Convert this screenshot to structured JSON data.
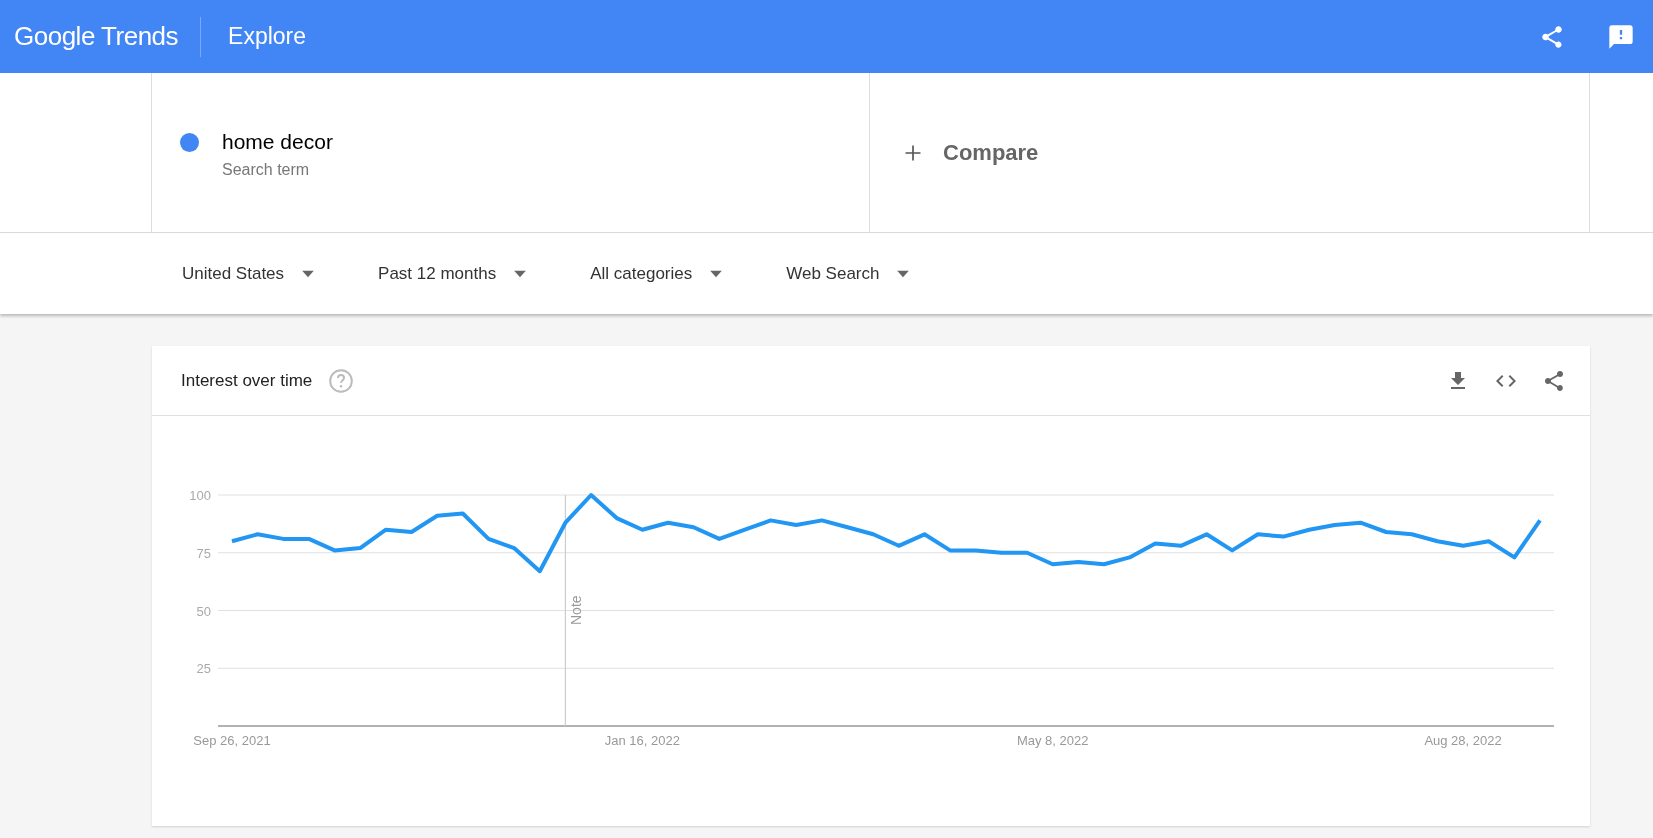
{
  "header": {
    "logo": "Google Trends",
    "title": "Explore"
  },
  "search_terms": [
    {
      "term": "home decor",
      "subtitle": "Search term",
      "color": "#4285f4"
    }
  ],
  "compare": {
    "label": "Compare"
  },
  "filters": [
    {
      "label": "United States"
    },
    {
      "label": "Past 12 months"
    },
    {
      "label": "All categories"
    },
    {
      "label": "Web Search"
    }
  ],
  "interest_card": {
    "title": "Interest over time",
    "chart_data": {
      "type": "line",
      "categories": [
        "Sep 26, 2021",
        null,
        null,
        null,
        null,
        null,
        null,
        null,
        null,
        null,
        null,
        null,
        null,
        null,
        null,
        null,
        "Jan 16, 2022",
        null,
        null,
        null,
        null,
        null,
        null,
        null,
        null,
        null,
        null,
        null,
        null,
        null,
        null,
        null,
        "May 8, 2022",
        null,
        null,
        null,
        null,
        null,
        null,
        null,
        null,
        null,
        null,
        null,
        null,
        null,
        null,
        null,
        "Aug 28, 2022",
        null,
        null,
        null
      ],
      "series": [
        {
          "color": "#2196f3",
          "values": [
            80,
            83,
            81,
            81,
            76,
            77,
            85,
            84,
            91,
            92,
            81,
            77,
            67,
            88,
            100,
            90,
            85,
            88,
            86,
            81,
            85,
            89,
            87,
            89,
            86,
            83,
            78,
            83,
            76,
            76,
            75,
            75,
            70,
            71,
            70,
            73,
            79,
            78,
            83,
            76,
            83,
            82,
            85,
            87,
            88,
            84,
            83,
            80,
            78,
            80,
            73,
            89
          ]
        }
      ],
      "ylim": [
        0,
        100
      ],
      "yticks": [
        25,
        50,
        75,
        100
      ],
      "grid": true,
      "annotations": [
        "Note"
      ]
    }
  }
}
